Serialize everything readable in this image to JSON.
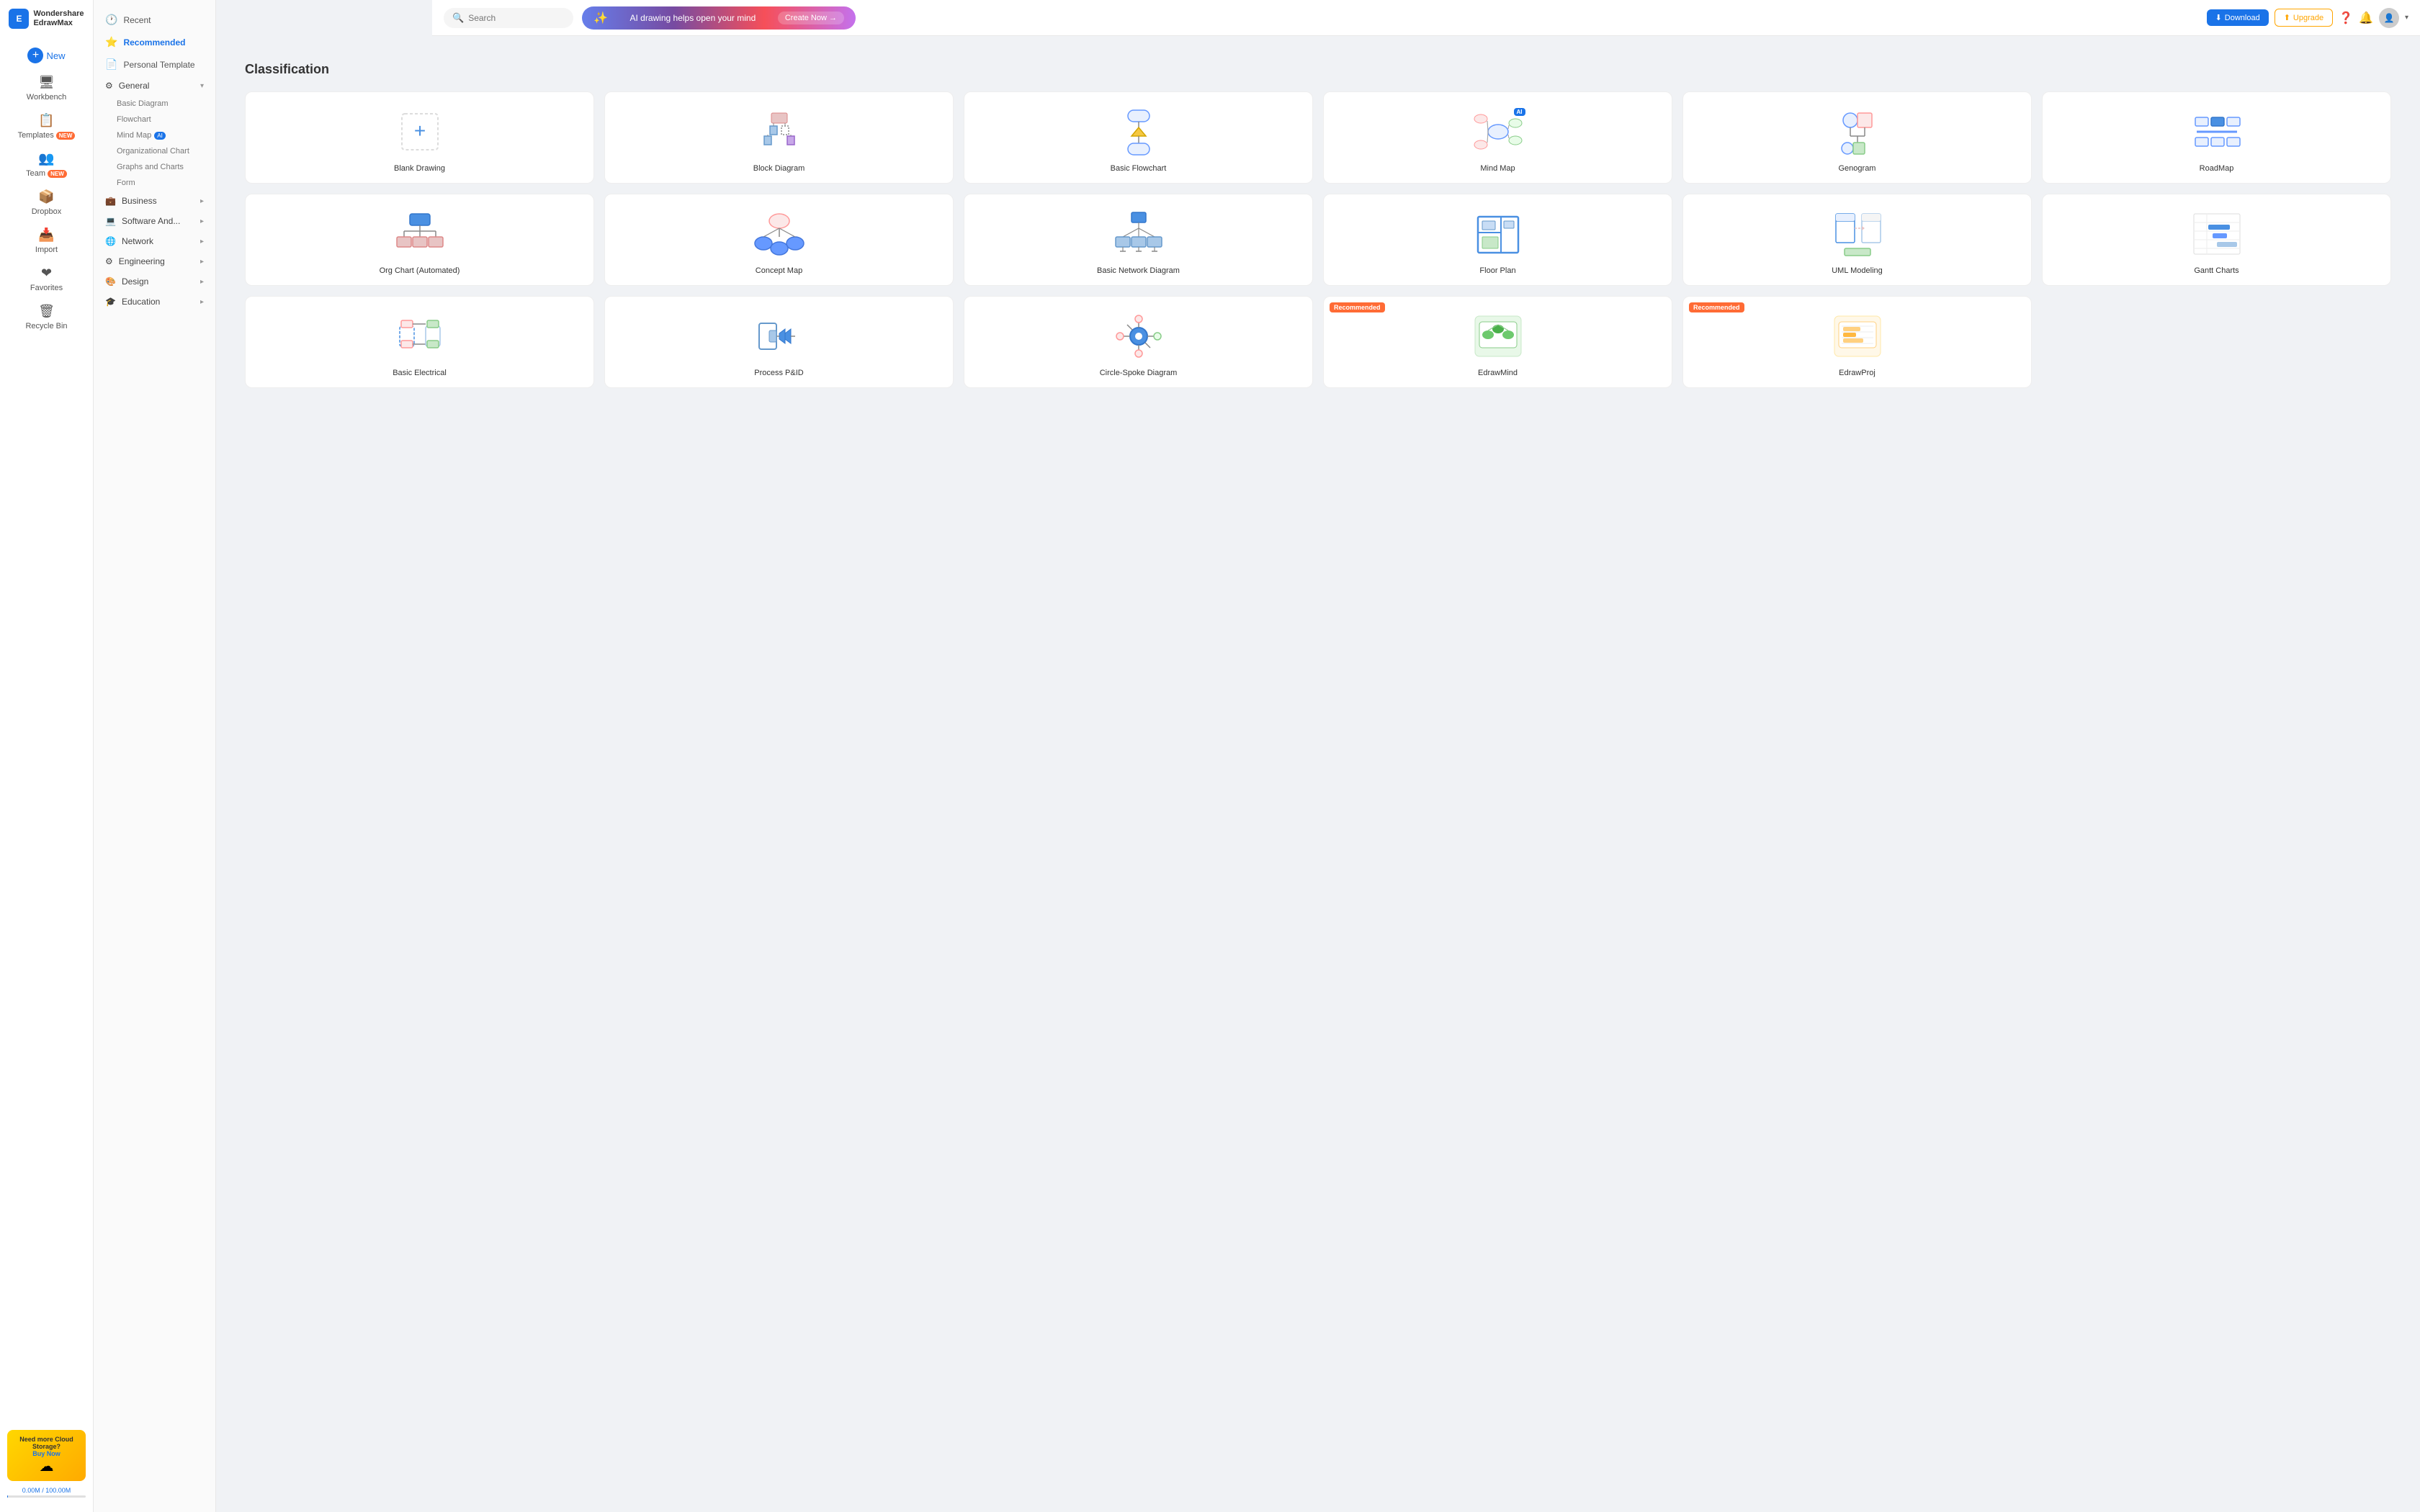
{
  "app": {
    "name": "Wondershare EdrawMax",
    "logo_letter": "E"
  },
  "header": {
    "search_placeholder": "Search",
    "ai_banner_text": "AI drawing helps open your mind",
    "ai_banner_cta": "Create Now →",
    "download_label": "Download",
    "upgrade_label": "Upgrade",
    "storage_text": "0.00M / 100.00M"
  },
  "sidebar_items": [
    {
      "id": "new",
      "label": "New",
      "icon": "+"
    },
    {
      "id": "workbench",
      "label": "Workbench",
      "icon": "🖥"
    },
    {
      "id": "templates",
      "label": "Templates",
      "icon": "📋",
      "badge": "NEW"
    },
    {
      "id": "team",
      "label": "Team",
      "icon": "👥",
      "badge": "NEW"
    },
    {
      "id": "dropbox",
      "label": "Dropbox",
      "icon": "📦"
    },
    {
      "id": "import",
      "label": "Import",
      "icon": "📥"
    },
    {
      "id": "favorites",
      "label": "Favorites",
      "icon": "❤"
    },
    {
      "id": "recycle",
      "label": "Recycle Bin",
      "icon": "🗑"
    }
  ],
  "nav": {
    "recent_label": "Recent",
    "recommended_label": "Recommended",
    "personal_template_label": "Personal Template",
    "general_label": "General",
    "general_subs": [
      "Basic Diagram",
      "Flowchart",
      "Mind Map",
      "Organizational Chart",
      "Graphs and Charts",
      "Form"
    ],
    "groups": [
      {
        "id": "business",
        "label": "Business"
      },
      {
        "id": "software",
        "label": "Software And..."
      },
      {
        "id": "network",
        "label": "Network"
      },
      {
        "id": "engineering",
        "label": "Engineering"
      },
      {
        "id": "design",
        "label": "Design"
      },
      {
        "id": "education",
        "label": "Education"
      }
    ]
  },
  "page_title": "Classification",
  "cloud_promo": {
    "title": "Need more Cloud Storage?",
    "buy": "Buy Now"
  },
  "cards": [
    {
      "id": "blank",
      "label": "Blank Drawing",
      "type": "blank"
    },
    {
      "id": "block",
      "label": "Block Diagram",
      "type": "block"
    },
    {
      "id": "flowchart",
      "label": "Basic Flowchart",
      "type": "flowchart"
    },
    {
      "id": "mindmap",
      "label": "Mind Map",
      "type": "mindmap",
      "ai": true
    },
    {
      "id": "genogram",
      "label": "Genogram",
      "type": "genogram"
    },
    {
      "id": "roadmap",
      "label": "RoadMap",
      "type": "roadmap"
    },
    {
      "id": "orgchart",
      "label": "Org Chart (Automated)",
      "type": "orgchart"
    },
    {
      "id": "concept",
      "label": "Concept Map",
      "type": "concept"
    },
    {
      "id": "network",
      "label": "Basic Network Diagram",
      "type": "network"
    },
    {
      "id": "floorplan",
      "label": "Floor Plan",
      "type": "floorplan"
    },
    {
      "id": "uml",
      "label": "UML Modeling",
      "type": "uml"
    },
    {
      "id": "gantt",
      "label": "Gantt Charts",
      "type": "gantt"
    },
    {
      "id": "electrical",
      "label": "Basic Electrical",
      "type": "electrical"
    },
    {
      "id": "process",
      "label": "Process P&ID",
      "type": "process"
    },
    {
      "id": "circle",
      "label": "Circle-Spoke Diagram",
      "type": "circle"
    },
    {
      "id": "edrawmind",
      "label": "EdrawMind",
      "type": "edrawmind",
      "recommended": true
    },
    {
      "id": "edrawproj",
      "label": "EdrawProj",
      "type": "edrawproj",
      "recommended": true
    }
  ]
}
